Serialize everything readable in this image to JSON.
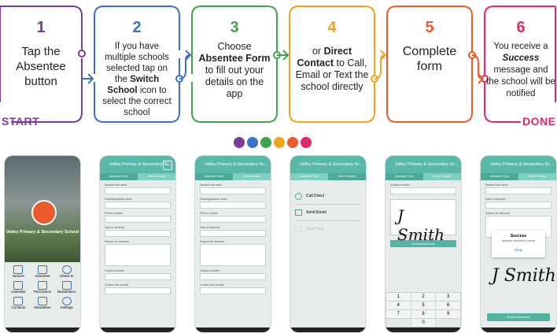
{
  "steps": [
    {
      "number": "1",
      "text_html": "Tap the Absentee button",
      "color": "#7a3b9a"
    },
    {
      "number": "2",
      "text_html": "If you have multiple schools selected tap on the <b>Switch School</b> icon to select the correct school",
      "color": "#3a73c6"
    },
    {
      "number": "3",
      "text_html": "Choose <b>Absentee Form</b> to fill out your details on the app",
      "color": "#3fa34d"
    },
    {
      "number": "4",
      "text_html": "or <b>Direct Contact</b> to Call, Email or Text the school directly",
      "color": "#f2a31c"
    },
    {
      "number": "5",
      "text_html": "Complete form",
      "color": "#ef5a2b"
    },
    {
      "number": "6",
      "text_html": "You receive a <b><i>Success</i></b> message and the school will be notified",
      "color": "#e3266e"
    }
  ],
  "start_label": "START",
  "done_label": "DONE",
  "dot_colors": [
    "#7a3b9a",
    "#3a73c6",
    "#3fa34d",
    "#f2a31c",
    "#ef5a2b",
    "#e3266e"
  ],
  "screens": {
    "school_name": "Valley Primary & Secondary School",
    "header_title": "Valley Primary & Secondary Sc...",
    "tab_absentee": "Absentee Form",
    "tab_direct": "Direct Contact",
    "home_icons": [
      "Notices",
      "Absentee",
      "Check In",
      "Calendar",
      "Permission",
      "Newsletters",
      "Contacts",
      "Newsletter",
      "Settings"
    ],
    "form_fields": [
      "Student first name",
      "Parent/guardian name",
      "Phone number",
      "Date of absence",
      "Reason for absence",
      "Contact number",
      "Confirm live (credit)"
    ],
    "contact_options": [
      "Call Direct",
      "Send Email",
      "Send Text"
    ],
    "signature": "J Smith",
    "submit_label": "Submit Absence",
    "success_title": "Success",
    "success_text": "Absence reported to school",
    "ok_label": "Okay",
    "keypad": [
      "1",
      "2",
      "3",
      "4",
      "5",
      "6",
      "7",
      "8",
      "9",
      "0"
    ]
  }
}
